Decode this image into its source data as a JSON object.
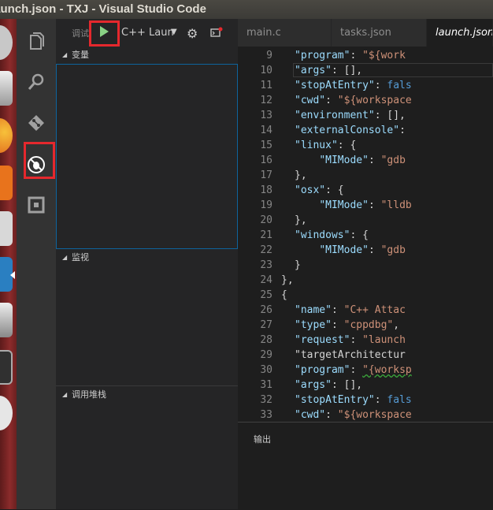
{
  "window": {
    "title": "launch.json - TXJ - Visual Studio Code"
  },
  "debug": {
    "label": "调试",
    "config": "C++ Laun",
    "sections": {
      "variables": "变量",
      "watch": "监视",
      "callstack": "调用堆栈"
    }
  },
  "tabs": [
    {
      "label": "main.c"
    },
    {
      "label": "tasks.json"
    },
    {
      "label": "launch.json"
    }
  ],
  "code": {
    "line_numbers": [
      "9",
      "10",
      "11",
      "12",
      "13",
      "14",
      "15",
      "16",
      "17",
      "18",
      "19",
      "20",
      "21",
      "22",
      "23",
      "24",
      "25",
      "26",
      "27",
      "28",
      "29",
      "30",
      "31",
      "32",
      "33"
    ],
    "lines": [
      "\"program\": \"${work",
      "\"args\": [],",
      "\"stopAtEntry\": fals",
      "\"cwd\": \"${workspace",
      "\"environment\": [],",
      "\"externalConsole\":",
      "\"linux\": {",
      "    \"MIMode\": \"gdb",
      "},",
      "\"osx\": {",
      "    \"MIMode\": \"lldb",
      "},",
      "\"windows\": {",
      "    \"MIMode\": \"gdb",
      "}",
      "},",
      "{",
      "\"name\": \"C++ Attac",
      "\"type\": \"cppdbg\",",
      "\"request\": \"launch",
      "\"targetArchitectur",
      "\"program\": \"{worksp",
      "\"args\": [],",
      "\"stopAtEntry\": fals",
      "\"cwd\": \"${workspace"
    ]
  },
  "panel": {
    "title": "输出"
  },
  "colors": {
    "highlight": "#e5282d",
    "accent": "#0e639c",
    "play": "#89d185"
  }
}
